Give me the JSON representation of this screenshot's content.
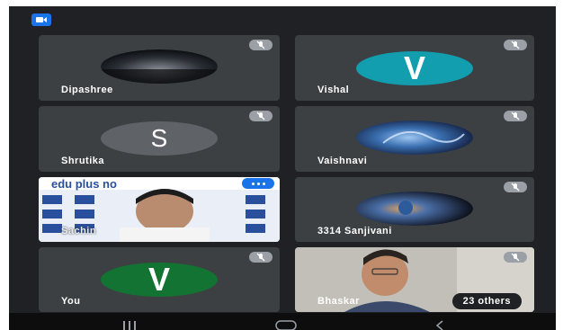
{
  "participants": [
    {
      "name": "Dipashree"
    },
    {
      "name": "Vishal",
      "initial": "V",
      "color": "#129eaf"
    },
    {
      "name": "Shrutika",
      "initial": "S",
      "color": "#5f6368"
    },
    {
      "name": "Vaishnavi"
    },
    {
      "name": "Sachin",
      "banner": "edu plus no"
    },
    {
      "name": "3314 Sanjivani"
    },
    {
      "name": "You",
      "initial": "V",
      "color": "#137333"
    },
    {
      "name": "Bhaskar"
    }
  ],
  "others_label": "23 others",
  "icons": {
    "top_left": "camera-icon",
    "tile_mic": "mic-off-icon",
    "nav": [
      "recents-icon",
      "home-icon",
      "back-icon"
    ]
  }
}
